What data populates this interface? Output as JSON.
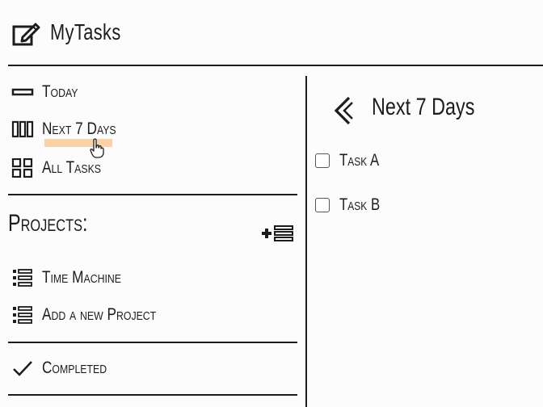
{
  "app": {
    "title": "MyTasks"
  },
  "sidebar": {
    "items": [
      {
        "label": "Today",
        "icon": "today-icon"
      },
      {
        "label": "Next 7 Days",
        "icon": "week-icon"
      },
      {
        "label": "All Tasks",
        "icon": "grid-icon"
      }
    ],
    "projects_title": "Projects:",
    "projects": [
      {
        "label": "Time Machine",
        "icon": "list-icon"
      },
      {
        "label": "Add a new Project",
        "icon": "list-icon"
      }
    ],
    "completed": {
      "label": "Completed",
      "icon": "check-icon"
    }
  },
  "main": {
    "title": "Next 7 Days",
    "tasks": [
      {
        "label": "Task A",
        "checked": false
      },
      {
        "label": "Task B",
        "checked": false
      }
    ]
  },
  "colors": {
    "highlight": "#fbd2a6",
    "ink": "#1c1c1c"
  }
}
